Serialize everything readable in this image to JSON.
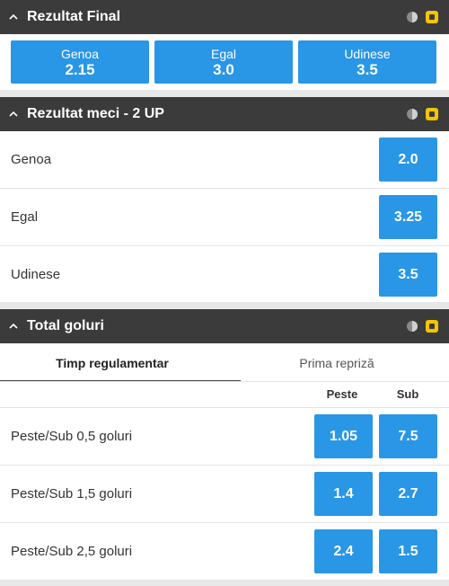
{
  "final_result": {
    "title": "Rezultat Final",
    "options": [
      {
        "label": "Genoa",
        "odds": "2.15"
      },
      {
        "label": "Egal",
        "odds": "3.0"
      },
      {
        "label": "Udinese",
        "odds": "3.5"
      }
    ]
  },
  "match_result_2up": {
    "title": "Rezultat meci - 2 UP",
    "rows": [
      {
        "label": "Genoa",
        "odds": "2.0"
      },
      {
        "label": "Egal",
        "odds": "3.25"
      },
      {
        "label": "Udinese",
        "odds": "3.5"
      }
    ]
  },
  "total_goals": {
    "title": "Total goluri",
    "tabs": [
      "Timp regulamentar",
      "Prima repriză"
    ],
    "active_tab": "Timp regulamentar",
    "columns": [
      "Peste",
      "Sub"
    ],
    "rows": [
      {
        "label": "Peste/Sub 0,5 goluri",
        "over": "1.05",
        "under": "7.5"
      },
      {
        "label": "Peste/Sub 1,5 goluri",
        "over": "1.4",
        "under": "2.7"
      },
      {
        "label": "Peste/Sub 2,5 goluri",
        "over": "2.4",
        "under": "1.5"
      }
    ]
  },
  "icons": {
    "collapse": "chevron-up-icon",
    "stats": "clock-icon",
    "favorite": "star-icon"
  },
  "colors": {
    "header_bg": "#3b3b3b",
    "odds_button": "#2996e6",
    "favorite_accent": "#f5c400"
  }
}
